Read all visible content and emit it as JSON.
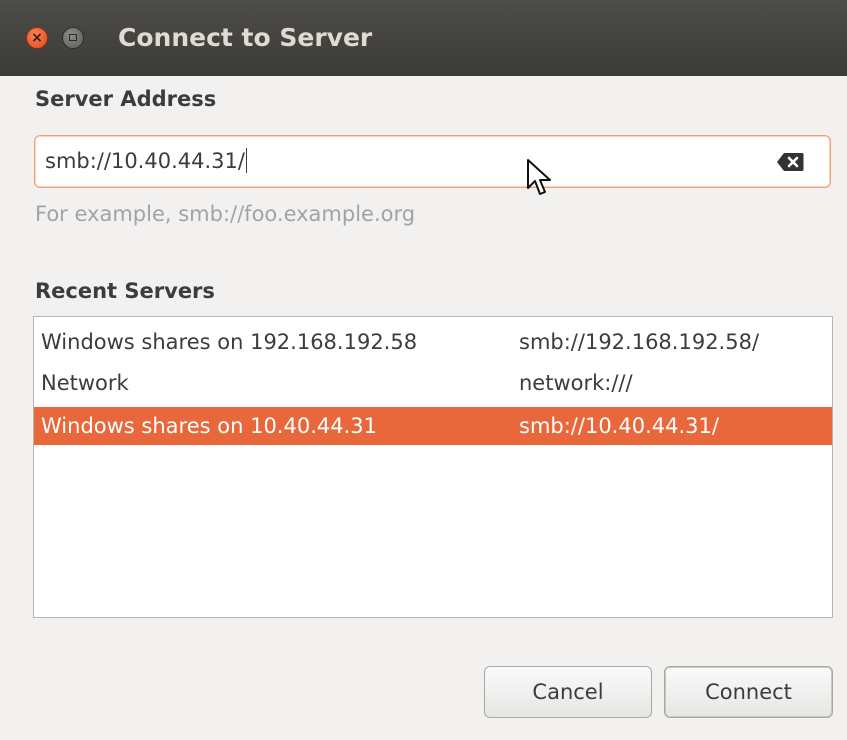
{
  "window": {
    "title": "Connect to Server"
  },
  "server_address": {
    "label": "Server Address",
    "value": "smb://10.40.44.31/",
    "hint": "For example, smb://foo.example.org"
  },
  "recent_servers": {
    "label": "Recent Servers",
    "rows": [
      {
        "name": "Windows shares on 192.168.192.58",
        "uri": "smb://192.168.192.58/",
        "selected": false
      },
      {
        "name": "Network",
        "uri": "network:///",
        "selected": false
      },
      {
        "name": "Windows shares on 10.40.44.31",
        "uri": "smb://10.40.44.31/",
        "selected": true
      }
    ]
  },
  "buttons": {
    "cancel": "Cancel",
    "connect": "Connect"
  },
  "colors": {
    "selection": "#e9683b",
    "titlebar": "#3c3b37",
    "focus_border": "#f0a07a"
  },
  "icons": {
    "close": "close-icon",
    "maximize": "maximize-icon",
    "clear": "clear-text-icon",
    "pointer": "mouse-pointer-icon"
  }
}
